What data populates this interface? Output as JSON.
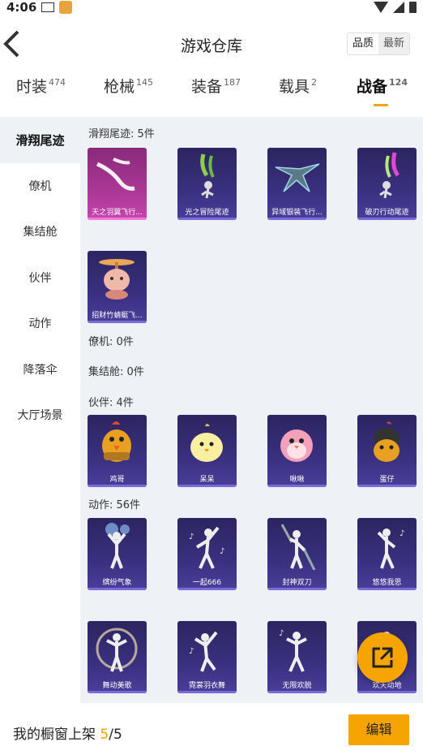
{
  "status": {
    "time": "4:06"
  },
  "header": {
    "title": "游戏仓库",
    "sort_quality": "品质",
    "sort_latest": "最新"
  },
  "tabs": [
    {
      "label": "时装",
      "count": "474"
    },
    {
      "label": "枪械",
      "count": "145"
    },
    {
      "label": "装备",
      "count": "187"
    },
    {
      "label": "载具",
      "count": "2"
    },
    {
      "label": "战备",
      "count": "124",
      "active": true
    }
  ],
  "sidebar": {
    "items": [
      "滑翔尾迹",
      "僚机",
      "集结舱",
      "伙伴",
      "动作",
      "降落伞",
      "大厅场景"
    ]
  },
  "sections": {
    "trail": {
      "label": "滑翔尾迹: 5件"
    },
    "wingman": {
      "label": "僚机: 0件"
    },
    "pod": {
      "label": "集结舱: 0件"
    },
    "partner": {
      "label": "伙伴: 4件"
    },
    "action": {
      "label": "动作: 56件"
    }
  },
  "cards": {
    "trail": [
      "天之羽翼飞行...",
      "光之冒险尾迹",
      "异域银装飞行...",
      "破刃行动尾迹",
      "招财竹蜻蜓飞..."
    ],
    "partner": [
      "鸡哥",
      "呆呆",
      "啾啾",
      "蛋仔"
    ],
    "action": [
      "缤纷气象",
      "一起666",
      "封神双刀",
      "悠悠我思",
      "舞动美歌",
      "霓裳羽衣舞",
      "无限欢脱",
      "欢天动地"
    ]
  },
  "footer": {
    "text": "我的橱窗上架",
    "current": "5",
    "sep": "/",
    "total": "5",
    "edit_label": "编辑"
  },
  "colors": {
    "accent": "#f5a400",
    "card_bg": "#2c2560",
    "content_bg": "#eef1f6"
  }
}
